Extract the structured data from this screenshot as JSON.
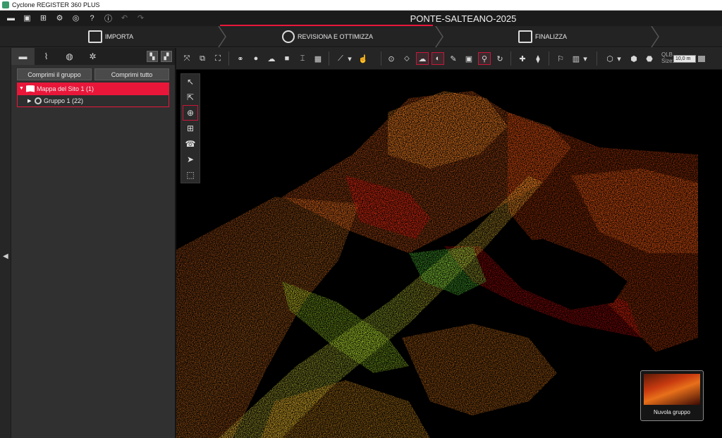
{
  "app": {
    "title": "Cyclone REGISTER 360 PLUS"
  },
  "project": {
    "title": "PONTE-SALTEANO-2025"
  },
  "quick_toolbar": {
    "items": [
      "folder-open-icon",
      "save-icon",
      "export-icon",
      "gear-icon",
      "database-icon",
      "help-icon",
      "info-icon",
      "undo-icon",
      "redo-icon"
    ]
  },
  "workflow": {
    "steps": [
      {
        "label": "IMPORTA",
        "icon": "import-icon"
      },
      {
        "label": "REVISIONA E OTTIMIZZA",
        "icon": "review-icon"
      },
      {
        "label": "FINALIZZA",
        "icon": "finalize-icon"
      }
    ]
  },
  "left_panel": {
    "tabs": [
      "folder-icon",
      "attachment-icon",
      "globe-icon",
      "bundle-icon"
    ],
    "buttons": {
      "collapse_group": "Comprimi il gruppo",
      "collapse_all": "Comprimi tutto"
    },
    "tree": {
      "site": "Mappa del Sito 1 (1)",
      "group": "Gruppo 1 (22)"
    }
  },
  "viewer": {
    "qlb_label": "QLB",
    "size_label": "Size:",
    "size_value": "10,0 m",
    "thumbnail_caption": "Nuvola gruppo"
  },
  "colors": {
    "accent": "#e8173a",
    "highlight_border": "#c9163a"
  }
}
